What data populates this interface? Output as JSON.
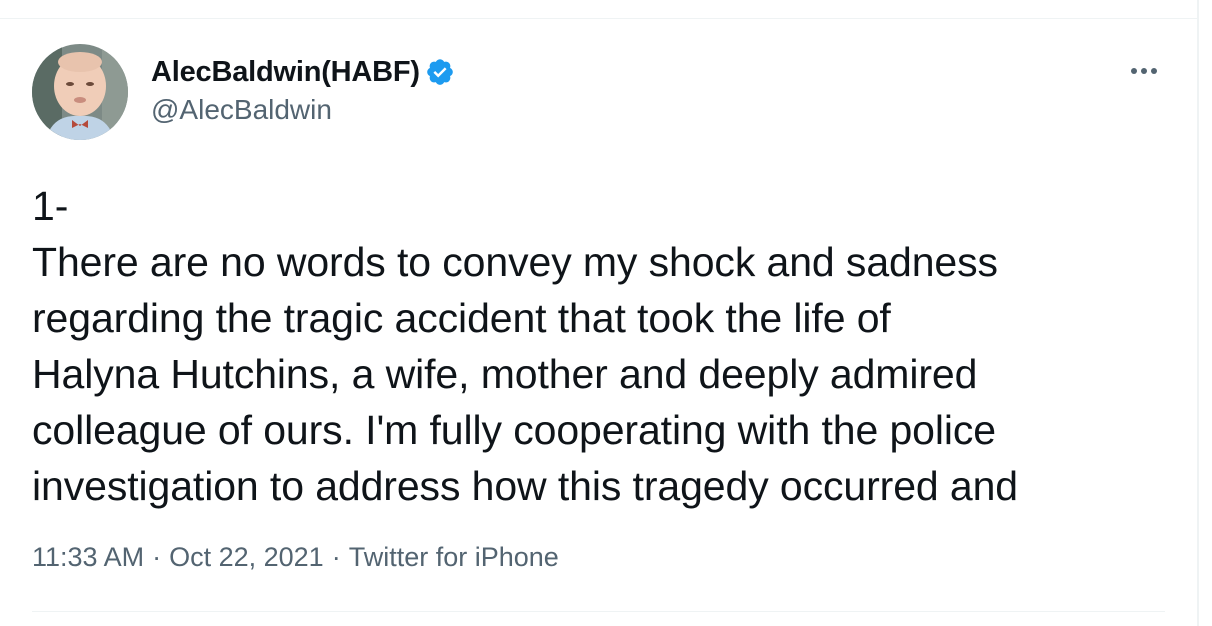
{
  "author": {
    "display_name": "AlecBaldwin(HABF)",
    "handle": "@AlecBaldwin",
    "verified": true,
    "avatar_icon": "baby-portrait-avatar"
  },
  "tweet": {
    "text": "1-\nThere are no words to convey my shock and sadness\nregarding the tragic accident that took the life of\nHalyna Hutchins, a wife, mother and deeply admired\ncolleague of ours. I'm fully cooperating with the police\ninvestigation to address how this tragedy occurred and"
  },
  "meta": {
    "time": "11:33 AM",
    "separator": "·",
    "date": "Oct 22, 2021",
    "source": "Twitter for iPhone"
  },
  "icons": {
    "verified": "verified-badge-icon",
    "more": "more-options-icon"
  },
  "colors": {
    "verified_blue": "#1d9bf0",
    "text_primary": "#0f1419",
    "text_secondary": "#536471",
    "divider": "#eff3f4"
  }
}
